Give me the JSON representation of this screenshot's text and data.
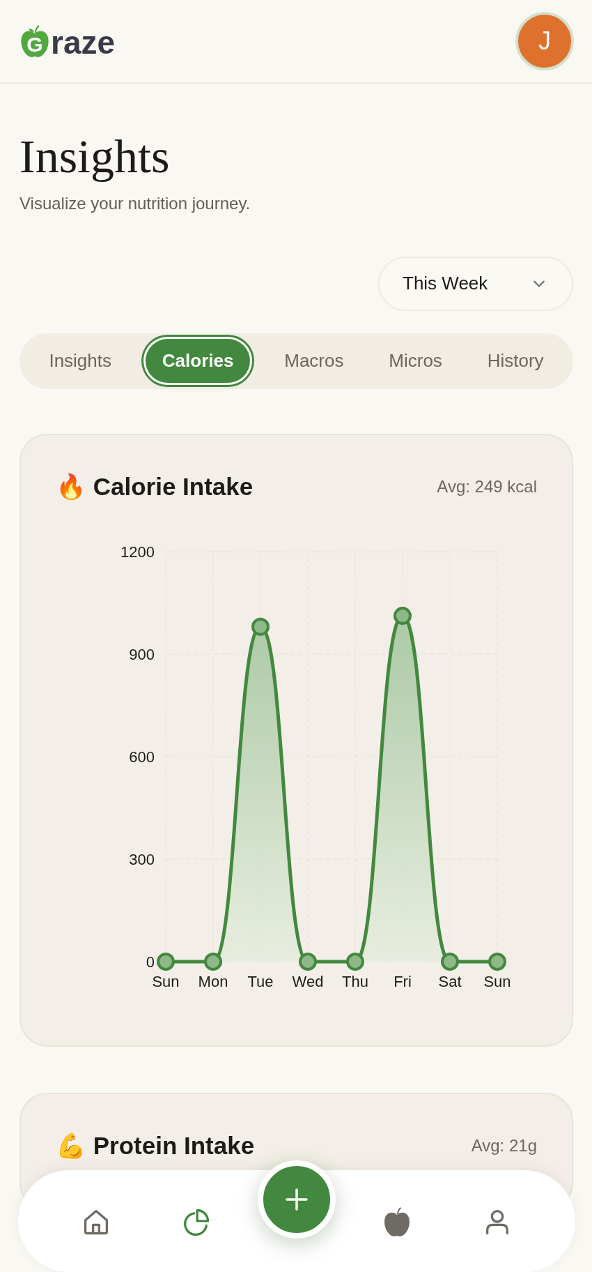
{
  "header": {
    "logo": {
      "initial": "G",
      "rest": "raze"
    },
    "avatar": "J"
  },
  "page": {
    "title": "Insights",
    "subtitle": "Visualize your nutrition journey."
  },
  "period": {
    "value": "This Week"
  },
  "tabs": [
    {
      "label": "Insights",
      "selected": false
    },
    {
      "label": "Calories",
      "selected": true
    },
    {
      "label": "Macros",
      "selected": false
    },
    {
      "label": "Micros",
      "selected": false
    },
    {
      "label": "History",
      "selected": false
    }
  ],
  "cards": [
    {
      "emoji": "🔥",
      "title": "Calorie Intake",
      "average": "Avg: 249 kcal",
      "chart_data": {
        "type": "area",
        "categories": [
          "Sun",
          "Mon",
          "Tue",
          "Wed",
          "Thu",
          "Fri",
          "Sat",
          "Sun"
        ],
        "grid": true,
        "series": [
          {
            "color": "#43883f",
            "values": [
              0,
              0,
              980,
              0,
              0,
              1012,
              0,
              0
            ]
          }
        ],
        "ylim": [
          0,
          1200
        ],
        "yticks": [
          0,
          300,
          600,
          900,
          1200
        ]
      }
    },
    {
      "emoji": "💪",
      "title": "Protein Intake",
      "average": "Avg: 21g"
    }
  ],
  "nav": [
    {
      "kind": "home",
      "selected": false
    },
    {
      "kind": "chart",
      "selected": true
    },
    {
      "kind": "add"
    },
    {
      "kind": "food",
      "selected": false
    },
    {
      "kind": "profile",
      "selected": false
    }
  ]
}
